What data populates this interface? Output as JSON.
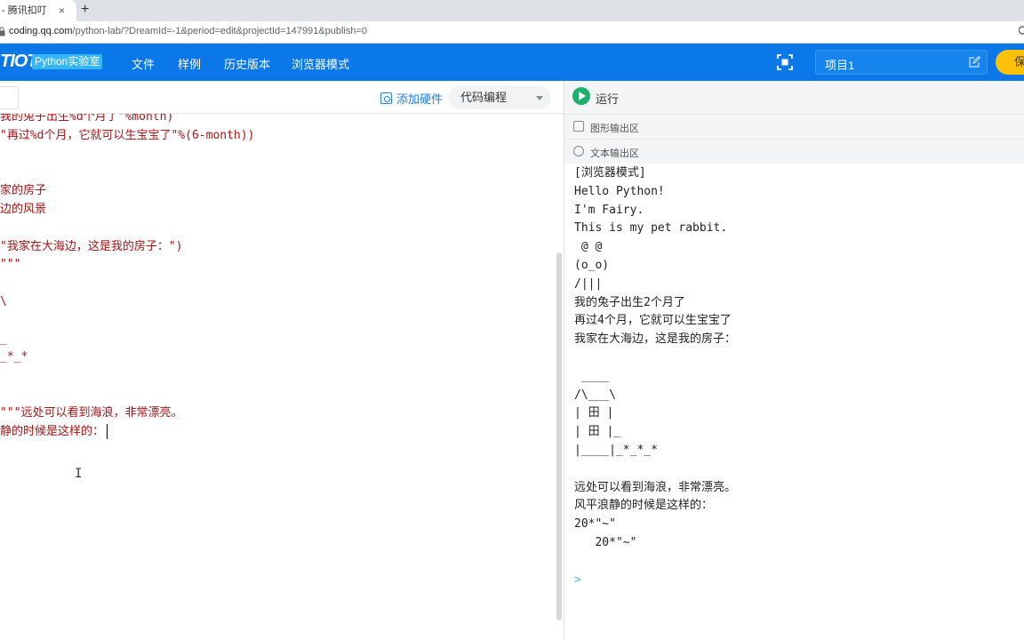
{
  "browser": {
    "tab_title": "- 腾讯扣叮",
    "tab_close": "×",
    "new_tab": "+",
    "url_host": "coding.qq.com",
    "url_path": "/python-lab/?DreamId=-1&period=edit&projectId=147991&publish=0"
  },
  "appbar": {
    "logo": "TIOT",
    "badge": "Python实验室",
    "menu": [
      "文件",
      "样例",
      "历史版本",
      "浏览器模式"
    ],
    "project_name": "项目1",
    "save_label": "保"
  },
  "editor": {
    "add_hardware": "添加硬件",
    "mode": "代码编程",
    "lines": [
      {
        "k": "",
        "s": "我的兔子出生%d个月了\"%month)"
      },
      {
        "k": "",
        "s": "\"再过%d个月，它就可以生宝宝了\"%(6-month))"
      },
      {
        "k": "",
        "s": ""
      },
      {
        "k": "",
        "s": ""
      },
      {
        "k": "",
        "s": "家的房子"
      },
      {
        "k": "",
        "s": "边的风景"
      },
      {
        "k": "",
        "s": ""
      },
      {
        "k": "",
        "s": "\"我家在大海边，这是我的房子：\")"
      },
      {
        "k": "",
        "s": "\"\"\""
      },
      {
        "k": "",
        "s": ""
      },
      {
        "k": "",
        "s": "\\"
      },
      {
        "k": "",
        "s": ""
      },
      {
        "k": "",
        "s": "_"
      },
      {
        "k": "",
        "s": "_*_*"
      },
      {
        "k": "",
        "s": ""
      },
      {
        "k": "",
        "s": ""
      },
      {
        "k": "",
        "s": "\"\"\"远处可以看到海浪，非常漂亮。"
      },
      {
        "k": "",
        "s": "静的时候是这样的："
      }
    ]
  },
  "output": {
    "run_label": "运行",
    "graphic_section": "图形输出区",
    "text_section": "文本输出区",
    "lines": [
      "[浏览器模式]",
      "Hello Python!",
      "I'm Fairy.",
      "This is my pet rabbit.",
      " @ @",
      "(o_o)",
      "/|||",
      "我的兔子出生2个月了",
      "再过4个月，它就可以生宝宝了",
      "我家在大海边，这是我的房子：",
      "",
      " ____",
      "/\\___\\",
      "| 田 |",
      "| 田 |_",
      "|____|_*_*_*",
      "",
      "远处可以看到海浪，非常漂亮。",
      "风平浪静的时候是这样的：",
      "20*\"~\"",
      "   20*\"~\""
    ],
    "prompt": ">"
  },
  "colors": {
    "brand": "#0a78e8",
    "save": "#ffc107",
    "run": "#1eb06d",
    "string": "#a31515"
  }
}
